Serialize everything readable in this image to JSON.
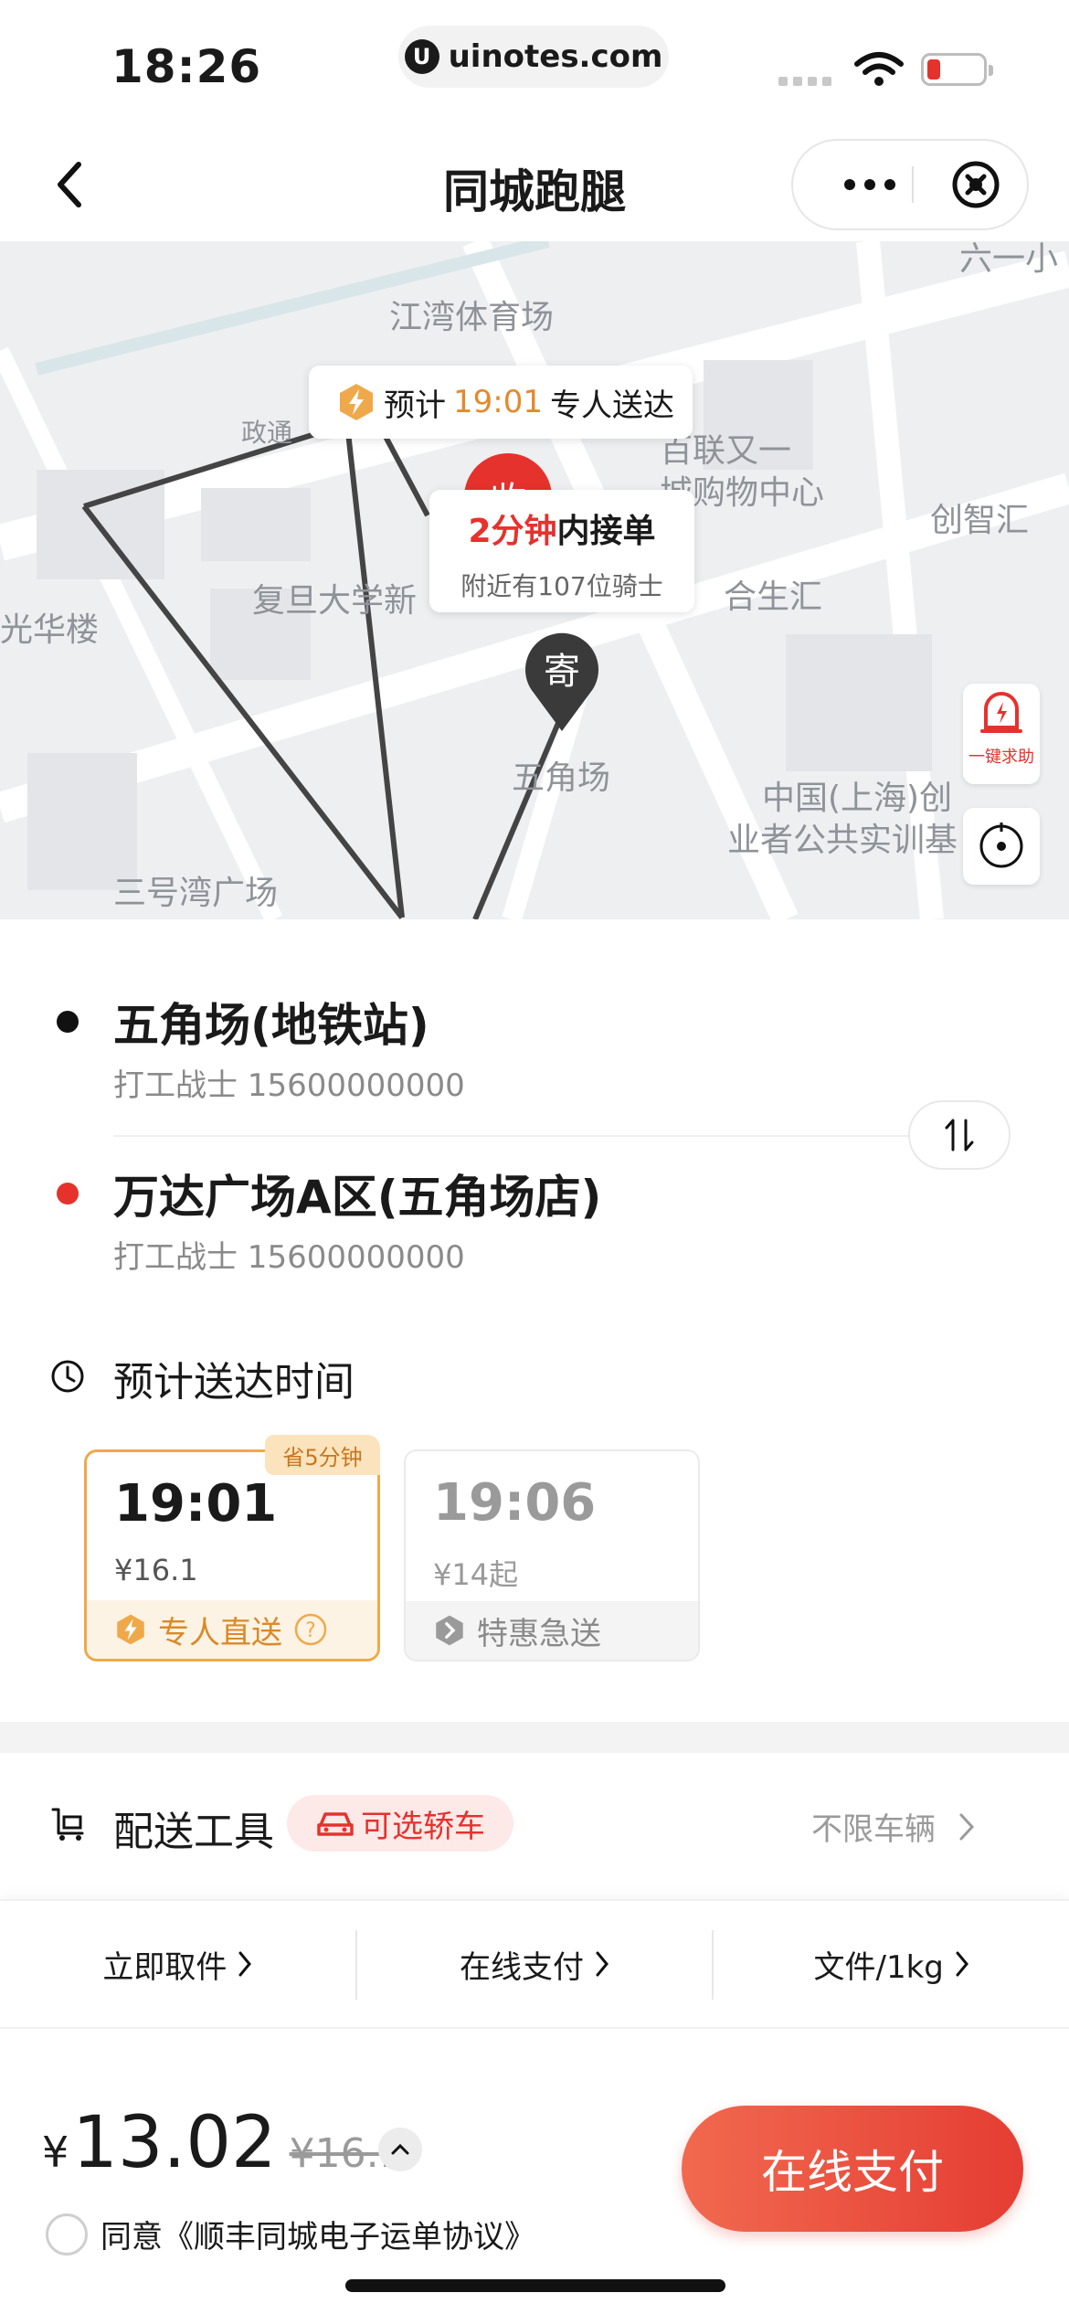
{
  "status_bar": {
    "time": "18:26",
    "url": "uinotes.com"
  },
  "nav": {
    "title": "同城跑腿"
  },
  "map": {
    "labels": {
      "stadium": "江湾体育场",
      "mall": "百联又一城购物中心",
      "mall_l1": "百联又一",
      "mall_l2": "城购物中心",
      "chuangzhi": "创智汇",
      "fudan": "复旦大学新",
      "hesheng": "合生汇",
      "wujiaochang": "五角场",
      "guanghua": "光华楼",
      "sanhaowan": "三号湾广场",
      "center_l1": "中国(上海)创",
      "center_l2": "业者公共实训基",
      "top_right": "六一小",
      "road": "政通"
    },
    "eta_prefix": "预计",
    "eta_time": "19:01",
    "eta_suffix": "专人送达",
    "pickup_pin": "收",
    "order_minutes": "2分钟",
    "order_text": "内接单",
    "riders_prefix": "附近有",
    "riders_count": "107",
    "riders_suffix": "位骑士",
    "send_pin": "寄",
    "sos_label": "一键求助"
  },
  "addresses": {
    "from": {
      "name": "五角场(地铁站)",
      "contact": "打工战士 15600000000"
    },
    "to": {
      "name": "万达广场A区(五角场店)",
      "contact": "打工战士 15600000000"
    }
  },
  "eta": {
    "title": "预计送达时间",
    "options": [
      {
        "time": "19:01",
        "price": "¥16.1",
        "label": "专人直送",
        "badge": "省5分钟"
      },
      {
        "time": "19:06",
        "price": "¥14起",
        "label": "特惠急送"
      }
    ]
  },
  "tool": {
    "label": "配送工具",
    "tag": "可选轿车",
    "value": "不限车辆"
  },
  "options_bar": [
    "立即取件",
    "在线支付",
    "文件/1kg"
  ],
  "pay": {
    "currency": "¥",
    "price": "13.02",
    "original": "¥16.1",
    "button": "在线支付",
    "agreement": "同意《顺丰同城电子运单协议》"
  },
  "colors": {
    "accent": "#e5322d",
    "orange": "#e48a2c",
    "selected_border": "#efa94a"
  }
}
